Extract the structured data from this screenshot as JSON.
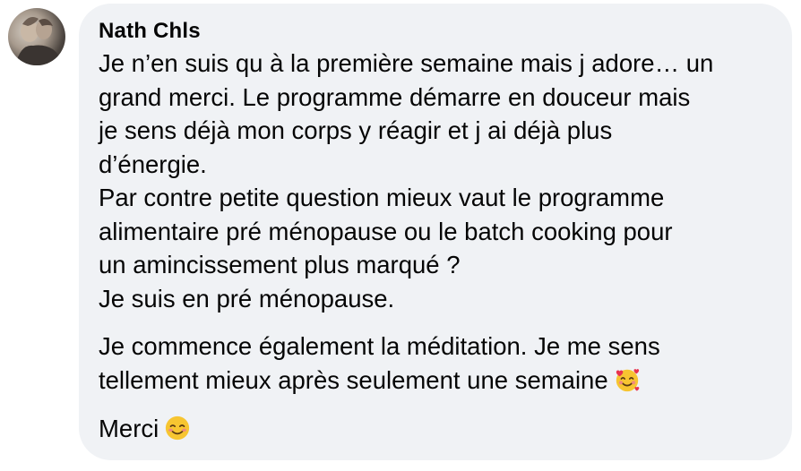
{
  "comment": {
    "author": "Nath Chls",
    "paragraphs": [
      {
        "lines": [
          "Je n’en suis qu à la première semaine mais j adore… un",
          "grand merci. Le programme démarre en douceur mais",
          "je sens déjà mon corps y réagir et j ai déjà plus",
          "d’énergie.",
          "Par contre petite question mieux vaut le programme",
          "alimentaire pré ménopause ou le batch cooking pour",
          "un amincissement plus marqué ?",
          "Je suis en pré ménopause."
        ]
      },
      {
        "lines": [
          "Je commence également la méditation. Je me sens",
          "tellement mieux après seulement une semaine"
        ],
        "end_emoji": "smiling-face-with-hearts-icon"
      },
      {
        "lines": [
          "Merci"
        ],
        "end_emoji": "smiling-face-icon"
      }
    ]
  },
  "colors": {
    "bubble_background": "#f0f2f5",
    "text": "#050505",
    "emoji_yellow": "#f7c531",
    "heart_red": "#e8344e"
  }
}
